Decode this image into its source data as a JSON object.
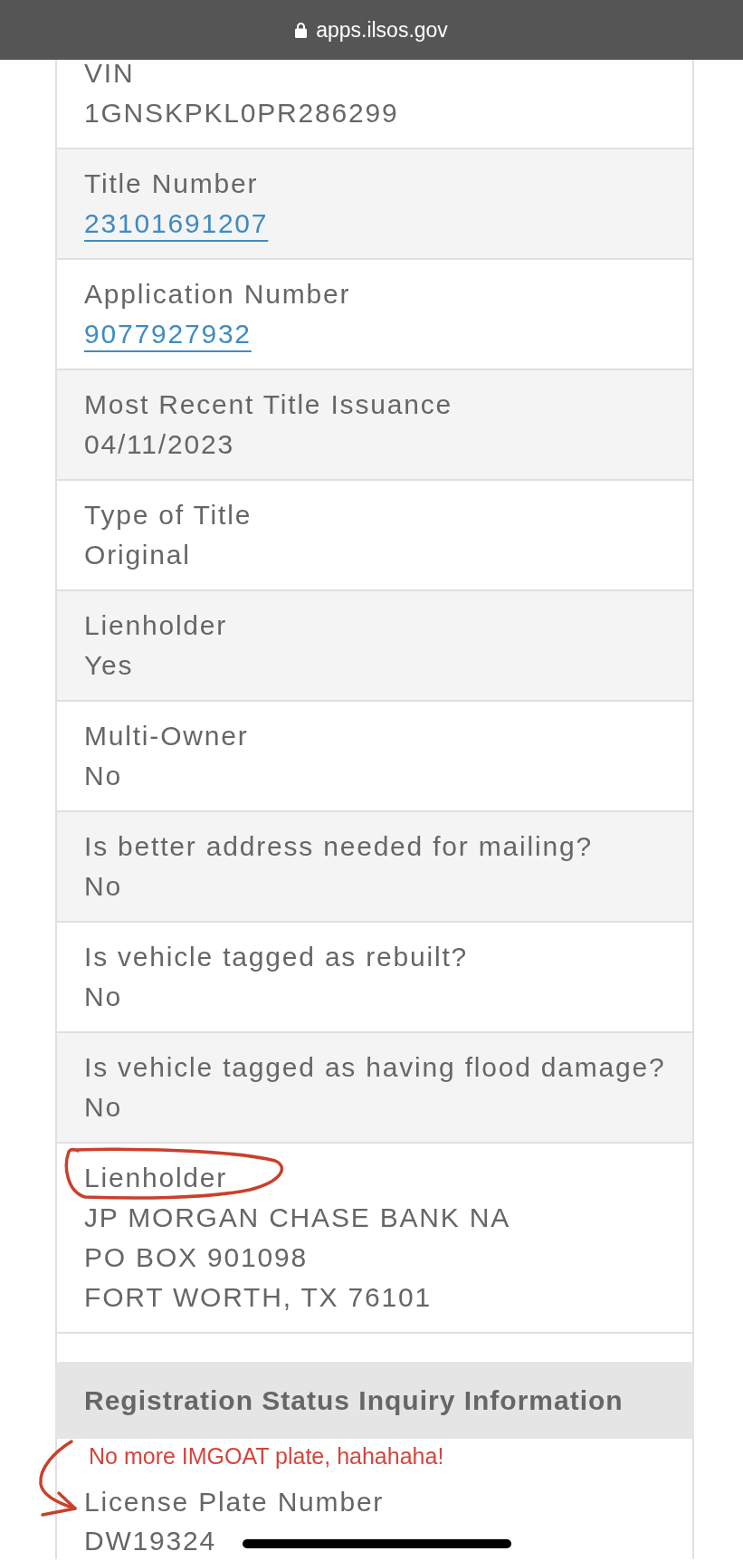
{
  "browser_bar": {
    "url": "apps.ilsos.gov"
  },
  "title_details": [
    {
      "kind": "text",
      "label": "VIN",
      "value": "1GNSKPKL0PR286299",
      "circled": false
    },
    {
      "kind": "link",
      "label": "Title Number",
      "value": "23101691207",
      "circled": false
    },
    {
      "kind": "link",
      "label": "Application Number",
      "value": "9077927932",
      "circled": false
    },
    {
      "kind": "text",
      "label": "Most Recent Title Issuance",
      "value": "04/11/2023",
      "circled": false
    },
    {
      "kind": "text",
      "label": "Type of Title",
      "value": "Original",
      "circled": false
    },
    {
      "kind": "text",
      "label": "Lienholder",
      "value": "Yes",
      "circled": false
    },
    {
      "kind": "text",
      "label": "Multi-Owner",
      "value": "No",
      "circled": false
    },
    {
      "kind": "text",
      "label": "Is better address needed for mailing?",
      "value": "No",
      "circled": false
    },
    {
      "kind": "text",
      "label": "Is vehicle tagged as rebuilt?",
      "value": "No",
      "circled": false
    },
    {
      "kind": "text",
      "label": "Is vehicle tagged as having flood damage?",
      "value": "No",
      "circled": false
    },
    {
      "kind": "address",
      "label": "Lienholder",
      "lines": [
        "JP MORGAN CHASE BANK NA",
        "PO BOX 901098",
        "FORT WORTH, TX 76101"
      ],
      "circled": true
    }
  ],
  "registration_section": {
    "title": "Registration Status Inquiry Information",
    "note": "No more IMGOAT plate, hahahaha!",
    "fields": [
      {
        "label": "License Plate Number",
        "value": "DW19324",
        "arrow_marked": true
      }
    ]
  }
}
